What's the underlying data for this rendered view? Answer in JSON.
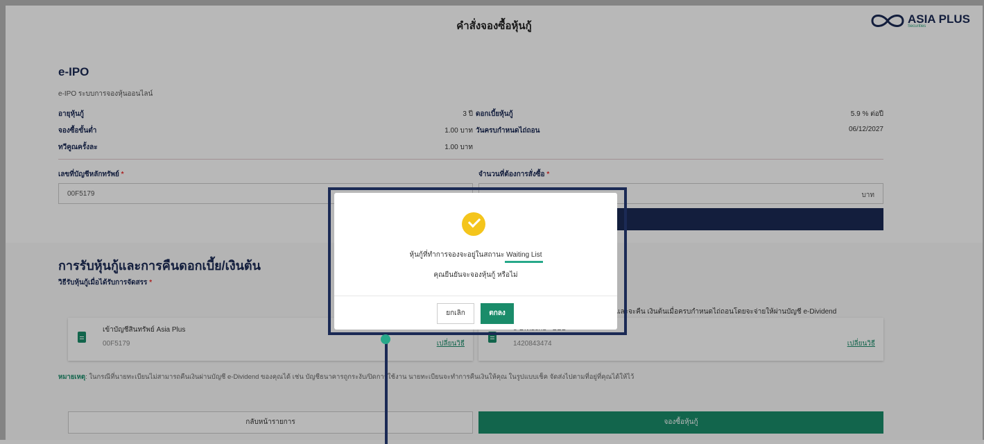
{
  "header": {
    "title": "คำสั่งจองซื้อหุ้นกู้",
    "logo_text": "ASIA PLUS",
    "logo_sub": "Securities"
  },
  "eipo": {
    "heading": "e-IPO",
    "subtitle": "e-IPO ระบบการจองหุ้นออนไลน์",
    "left_rows": [
      {
        "label": "อายุหุ้นกู้",
        "value": "3 ปี"
      },
      {
        "label": "จองซื้อขั้นต่ำ",
        "value": "1.00 บาท"
      },
      {
        "label": "ทวีคูณครั้งละ",
        "value": "1.00 บาท"
      }
    ],
    "right_rows": [
      {
        "label": "ดอกเบี้ยหุ้นกู้",
        "value": "5.9 % ต่อปี"
      },
      {
        "label": "วันครบกำหนดไถ่ถอน",
        "value": "06/12/2027"
      }
    ],
    "account_label": "เลขที่บัญชีหลักทรัพย์",
    "account_value": "00F5179",
    "amount_label": "จำนวนที่ต้องการสั่งซื้อ",
    "amount_unit": "บาท",
    "required_mark": "*"
  },
  "receive": {
    "heading": "การรับหุ้นกู้และการคืนดอกเบี้ย/เงินต้น",
    "method_label": "วิธีรับหุ้นกู้เมื่อได้รับการจัดสรร",
    "right_note": "และจะคืน เงินต้นเมื่อครบกำหนดไถ่ถอนโดยจะจ่ายให้ผ่านบัญชี e-Dividend",
    "left_card": {
      "name": "เข้าบัญชีสินทรัพย์ Asia Plus",
      "account": "00F5179",
      "link": "เปลี่ยนวิธี"
    },
    "right_card": {
      "name": "e-Dividend - BBL",
      "account": "1420843474",
      "link": "เปลี่ยนวิธี"
    },
    "remark_label": "หมายเหตุ",
    "remark_text": ": ในกรณีที่นายทะเบียนไม่สามารถคืนเงินผ่านบัญชี e-Dividend ของคุณได้ เช่น บัญชีธนาคารถูกระงับ/ปิดการใช้งาน นายทะเบียนจะทำการคืนเงินให้คุณ ในรูปแบบเช็ค จัดส่งไปตามที่อยู่ที่คุณได้ให้ไว้"
  },
  "footer": {
    "back_label": "กลับหน้ารายการ",
    "book_label": "จองซื้อหุ้นกู้"
  },
  "modal": {
    "message_prefix": "หุ้นกู้ที่ทำการจองจะอยู่ในสถานะ",
    "status": "Waiting List",
    "confirm": "คุณยืนยันจะจองหุ้นกู้ หรือไม่",
    "cancel_label": "ยกเลิก",
    "ok_label": "ตกลง"
  },
  "colors": {
    "brand_navy": "#1b2a55",
    "brand_green": "#1a8c6a",
    "check_yellow": "#f4c51c"
  }
}
